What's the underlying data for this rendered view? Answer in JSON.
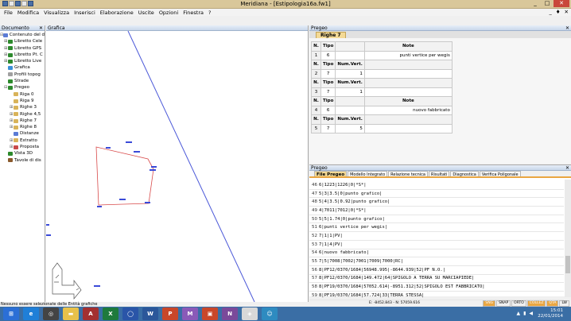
{
  "app": {
    "title": "Meridiana - [Estipologia16a.fw1]",
    "window_buttons": [
      "_",
      "□",
      "✕"
    ]
  },
  "menu": {
    "items": [
      "File",
      "Modifica",
      "Visualizza",
      "Inserisci",
      "Elaborazione",
      "Uscite",
      "Opzioni",
      "Finestra",
      "?"
    ],
    "mdi_buttons": [
      "_",
      "♦",
      "✕"
    ]
  },
  "document_panel": {
    "header": "Documento",
    "close": "✕",
    "tree": [
      {
        "label": "Contenuto del d",
        "expander": "⊟",
        "color": "#5b7bd5"
      },
      {
        "label": "Libretto Cele",
        "expander": "⊞",
        "color": "#2d8a2d"
      },
      {
        "label": "Libretto GPS",
        "expander": "⊞",
        "color": "#2d8a2d"
      },
      {
        "label": "Libretto Pt. C",
        "expander": "⊞",
        "color": "#2d8a2d"
      },
      {
        "label": "Libretto Live",
        "expander": "⊞",
        "color": "#2d8a2d"
      },
      {
        "label": "Grafica",
        "expander": "",
        "color": "#3a8fd8"
      },
      {
        "label": "Profili topog",
        "expander": "",
        "color": "#a0a0a0"
      },
      {
        "label": "Strade",
        "expander": "",
        "color": "#2d8a2d"
      },
      {
        "label": "Pregeo",
        "expander": "⊟",
        "color": "#2d8a2d"
      },
      {
        "label": "Riga 0",
        "expander": "",
        "color": "#d8b35a"
      },
      {
        "label": "Riga 9",
        "expander": "",
        "color": "#d8b35a"
      },
      {
        "label": "Righe 3",
        "expander": "⊞",
        "color": "#d8b35a"
      },
      {
        "label": "Righe 4,5",
        "expander": "⊞",
        "color": "#d8b35a"
      },
      {
        "label": "Righe 7",
        "expander": "⊞",
        "color": "#d8b35a"
      },
      {
        "label": "Righe 8",
        "expander": "⊞",
        "color": "#d8b35a"
      },
      {
        "label": "Distanze",
        "expander": "",
        "color": "#5b7bd5"
      },
      {
        "label": "Estratto",
        "expander": "⊞",
        "color": "#d8b35a"
      },
      {
        "label": "Proposta",
        "expander": "⊞",
        "color": "#c84a4a"
      },
      {
        "label": "Vista 3D",
        "expander": "",
        "color": "#2d8a2d"
      },
      {
        "label": "Tavole di dis",
        "expander": "",
        "color": "#8a5a2d"
      }
    ]
  },
  "grafica_panel": {
    "header": "Grafica"
  },
  "prospect_panel": {
    "header": "Pregeo",
    "close": "✕",
    "tab": "Righe 7",
    "table": [
      {
        "n": "N.",
        "c1": "Tipo",
        "c2": "",
        "c3": "Note",
        "header": true
      },
      {
        "n": "1",
        "c1": "6",
        "c2": "",
        "c3": "punti vertice per wegis",
        "header": false
      },
      {
        "n": "N.",
        "c1": "Tipo",
        "c2": "Num.Vert.",
        "c3": "",
        "header": true
      },
      {
        "n": "2",
        "c1": "7",
        "c2": "1",
        "c3": "",
        "header": false
      },
      {
        "n": "N.",
        "c1": "Tipo",
        "c2": "Num.Vert.",
        "c3": "",
        "header": true
      },
      {
        "n": "3",
        "c1": "7",
        "c2": "1",
        "c3": "",
        "header": false
      },
      {
        "n": "N.",
        "c1": "Tipo",
        "c2": "",
        "c3": "Note",
        "header": true
      },
      {
        "n": "4",
        "c1": "6",
        "c2": "",
        "c3": "nuovo fabbricato",
        "header": false
      },
      {
        "n": "N.",
        "c1": "Tipo",
        "c2": "Num.Vert.",
        "c3": "",
        "header": true
      },
      {
        "n": "5",
        "c1": "7",
        "c2": "5",
        "c3": "",
        "header": false
      }
    ]
  },
  "file_panel": {
    "header": "Pregeo",
    "close": "✕",
    "tabs": [
      "File Pregeo",
      "Modello Integrato",
      "Relazione tecnica",
      "Risultati",
      "Diagnostica",
      "Verifica Poligonale"
    ],
    "lines": [
      {
        "no": "46",
        "text": "6|1223|1226|0|*S*|"
      },
      {
        "no": "47",
        "text": "5|3|3.5|0|punto grafico|"
      },
      {
        "no": "48",
        "text": "5|4|3.5|0.92|punto grafico|"
      },
      {
        "no": "49",
        "text": "4|7011|7012|0|*S*|"
      },
      {
        "no": "50",
        "text": "5|5|1.74|0|punto grafico|"
      },
      {
        "no": "51",
        "text": "6|punti vertice per wegis|"
      },
      {
        "no": "52",
        "text": "7|1|1|PV|"
      },
      {
        "no": "53",
        "text": "7|1|4|PV|"
      },
      {
        "no": "54",
        "text": "6|nuovo fabbricato|"
      },
      {
        "no": "55",
        "text": "7|5|7008|7002|7001|7009|7000|RC|"
      },
      {
        "no": "56",
        "text": "8|PF12/0370/1684|56948.995|-8644.939|52|PF N.O.|"
      },
      {
        "no": "57",
        "text": "8|PF12/0370/1684|149.472|64|SPIGOLO A TERRA SU MARCIAPIEDE|"
      },
      {
        "no": "58",
        "text": "8|PF19/0370/1684|57052.614|-8951.312|52|SPIGOLO EST FABBRICATO|"
      },
      {
        "no": "59",
        "text": "8|PF19/0370/1684|57.724|33|TERRA STESSA|"
      }
    ]
  },
  "status": {
    "left_text": "Nessuno essere selezionate delle Entità grafiche",
    "coords": "E: -8452.843 - N: 57059.616",
    "modes": [
      {
        "label": "SNG",
        "on": true
      },
      {
        "label": "SNAP",
        "on": false
      },
      {
        "label": "ORTO",
        "on": false
      },
      {
        "label": "COLLEZ",
        "on": true
      },
      {
        "label": "QTA",
        "on": true
      },
      {
        "label": "LW",
        "on": false
      }
    ]
  },
  "taskbar": {
    "apps": [
      {
        "label": "⊞",
        "color": "#2b6fd6"
      },
      {
        "label": "e",
        "color": "#1f7fd8"
      },
      {
        "label": "◎",
        "color": "#444"
      },
      {
        "label": "▬",
        "color": "#e8c14a"
      },
      {
        "label": "A",
        "color": "#a33030"
      },
      {
        "label": "X",
        "color": "#1e7a3c"
      },
      {
        "label": "◯",
        "color": "#2a55a8"
      },
      {
        "label": "W",
        "color": "#2b579a"
      },
      {
        "label": "P",
        "color": "#c9472a"
      },
      {
        "label": "M",
        "color": "#8a5ab8"
      },
      {
        "label": "▣",
        "color": "#c9472a"
      },
      {
        "label": "N",
        "color": "#7a4a9a"
      },
      {
        "label": "◈",
        "color": "#d8d8d8"
      },
      {
        "label": "☺",
        "color": "#2e8bc0"
      }
    ],
    "time": "15:01",
    "date": "22/01/2014"
  }
}
